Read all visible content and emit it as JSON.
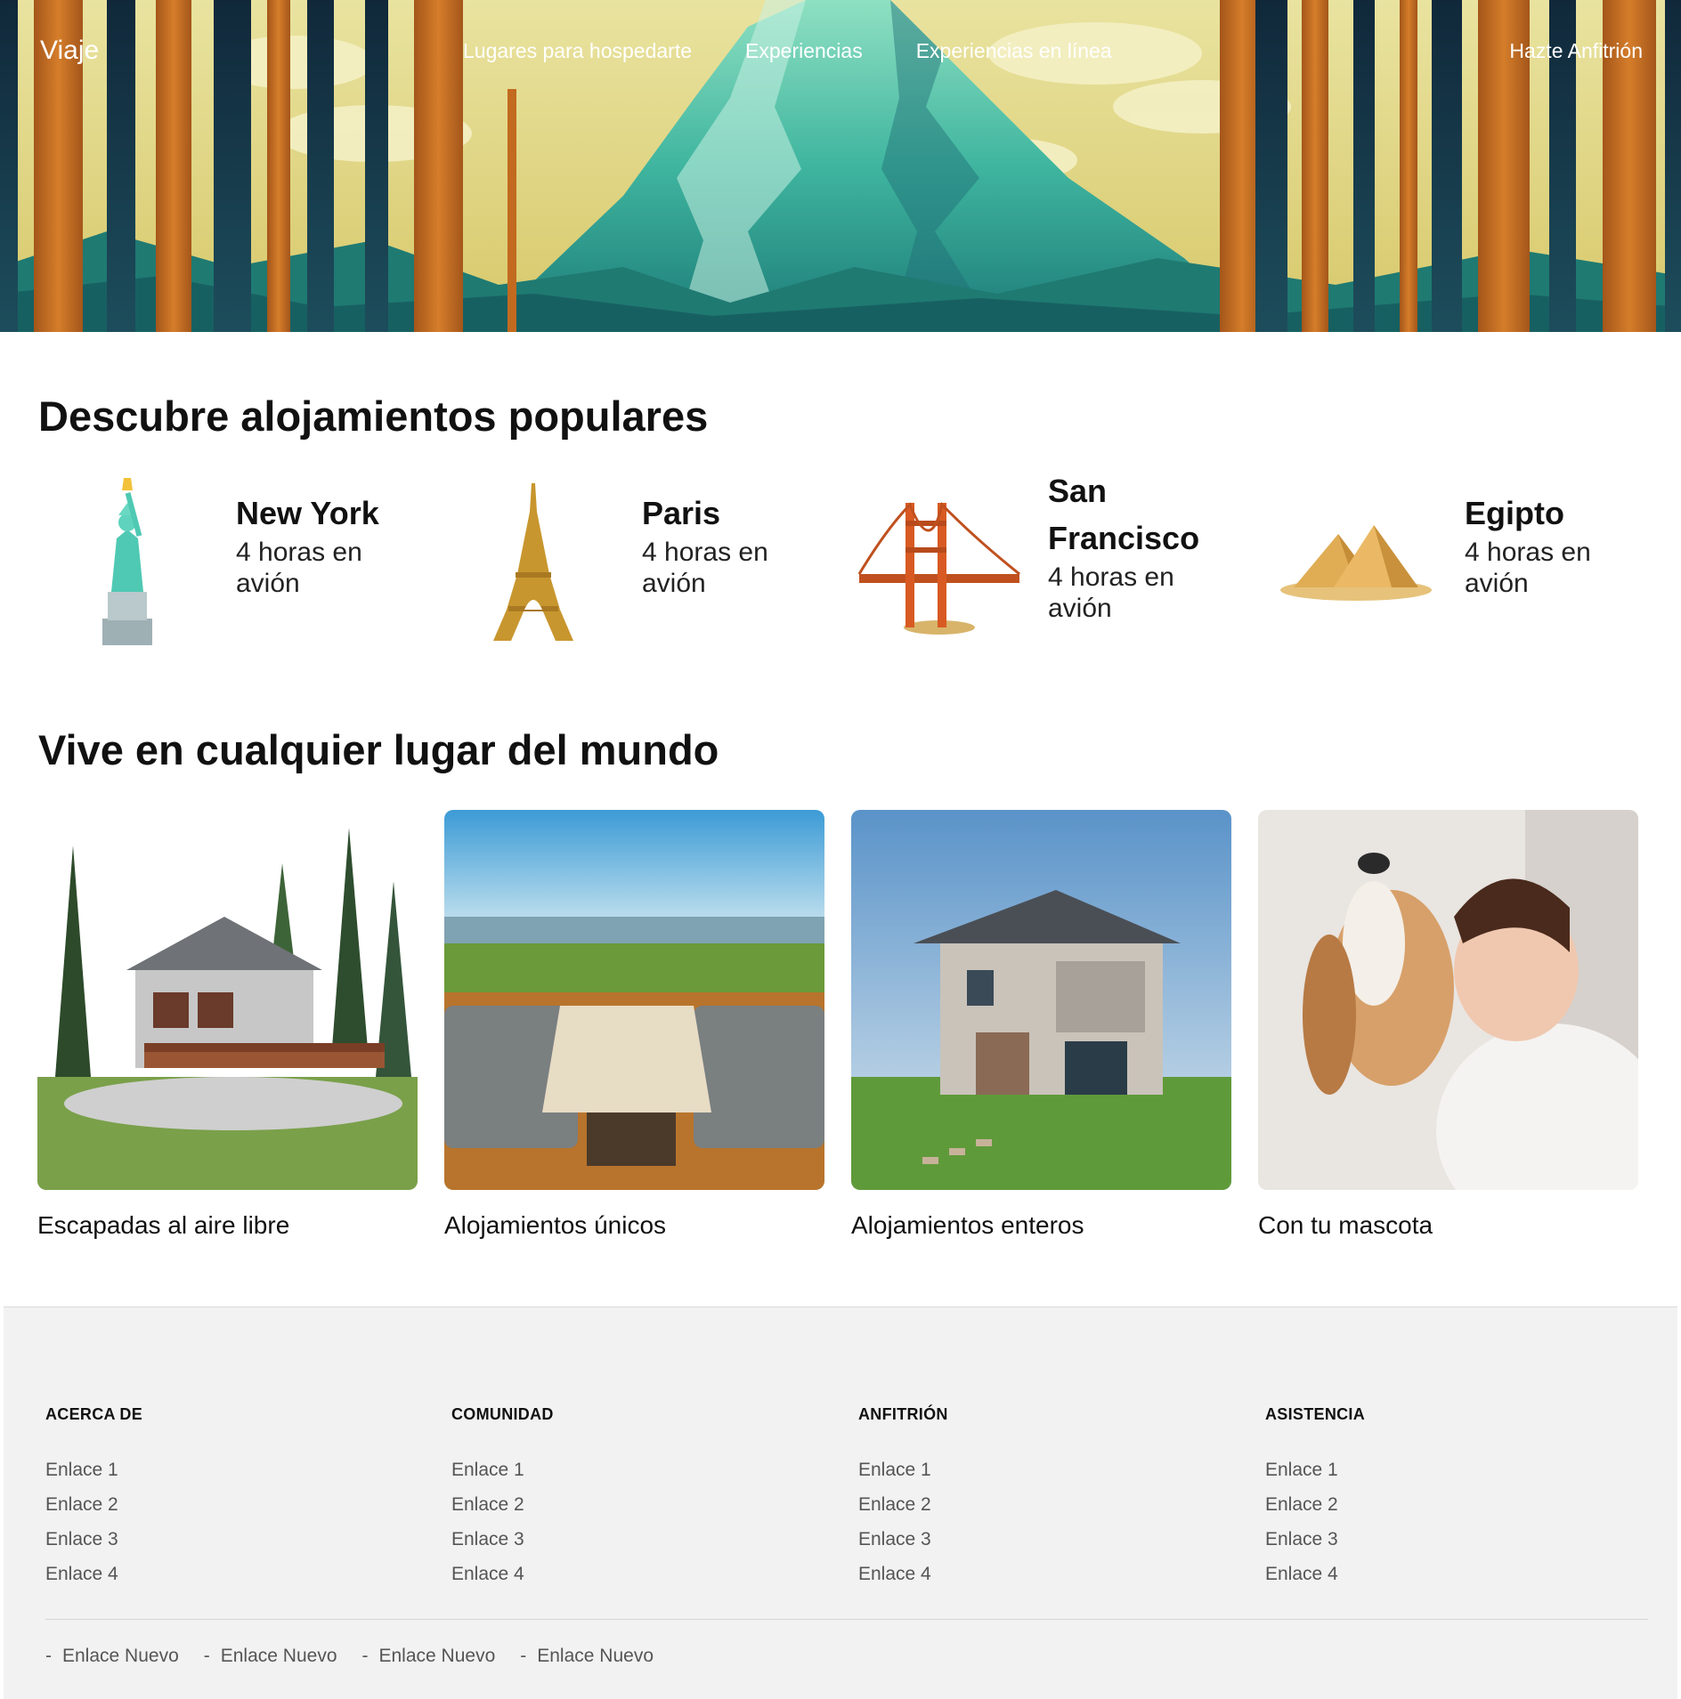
{
  "header": {
    "brand": "Viaje",
    "nav": [
      "Lugares para hospedarte",
      "Experiencias",
      "Experiencias en línea"
    ],
    "host_link": "Hazte Anfitrión"
  },
  "popular": {
    "title": "Descubre alojamientos populares",
    "destinations": [
      {
        "name": "New York",
        "time": "4 horas en avión",
        "icon": "statue-of-liberty-icon"
      },
      {
        "name": "Paris",
        "time": "4 horas en avión",
        "icon": "eiffel-tower-icon"
      },
      {
        "name": "San Francisco",
        "time": "4 horas en avión",
        "icon": "golden-gate-bridge-icon"
      },
      {
        "name": "Egipto",
        "time": "4 horas en avión",
        "icon": "pyramids-icon"
      }
    ]
  },
  "live": {
    "title": "Vive en cualquier lugar del mundo",
    "cards": [
      {
        "label": "Escapadas al aire libre"
      },
      {
        "label": "Alojamientos únicos"
      },
      {
        "label": "Alojamientos enteros"
      },
      {
        "label": "Con tu mascota"
      }
    ]
  },
  "footer": {
    "columns": [
      {
        "title": "ACERCA DE",
        "links": [
          "Enlace 1",
          "Enlace 2",
          "Enlace 3",
          "Enlace 4"
        ]
      },
      {
        "title": "COMUNIDAD",
        "links": [
          "Enlace 1",
          "Enlace 2",
          "Enlace 3",
          "Enlace 4"
        ]
      },
      {
        "title": "ANFITRIÓN",
        "links": [
          "Enlace 1",
          "Enlace 2",
          "Enlace 3",
          "Enlace 4"
        ]
      },
      {
        "title": "ASISTENCIA",
        "links": [
          "Enlace 1",
          "Enlace 2",
          "Enlace 3",
          "Enlace 4"
        ]
      }
    ],
    "bottom_links": [
      "Enlace Nuevo",
      "Enlace Nuevo",
      "Enlace Nuevo",
      "Enlace Nuevo"
    ]
  },
  "colors": {
    "hero_sky": "#e8e08a",
    "hero_mountain": "#2f9e8f",
    "tree_orange": "#c26a1f",
    "tree_dark": "#173447",
    "footer_bg": "#f2f2f2"
  }
}
